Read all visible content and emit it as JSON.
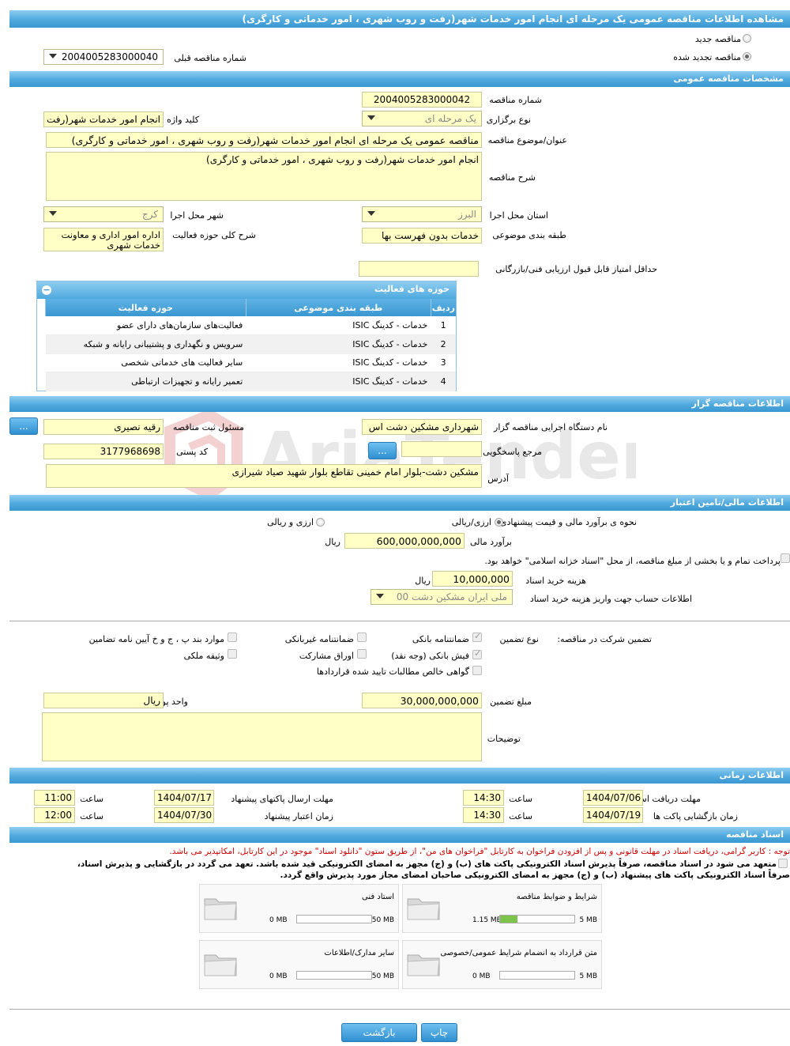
{
  "page_title": "مشاهده اطلاعات مناقصه عمومی یک مرحله ای انجام امور خدمات شهر(رفت و روب شهری ، امور خدماتی و کارگری)",
  "tender_type": {
    "new_label": "مناقصه جدید",
    "renewed_label": "مناقصه تجدید شده",
    "previous_number_label": "شماره مناقصه قبلی",
    "previous_number_value": "2004005283000040"
  },
  "general": {
    "header": "مشخصات مناقصه عمومی",
    "number_label": "شماره مناقصه",
    "number_value": "2004005283000042",
    "holding_type_label": "نوع برگزاری",
    "holding_type_value": "یک مرحله ای",
    "keyword_label": "کلید واژه",
    "keyword_value": "انجام امور خدمات شهر(رفت",
    "subject_label": "عنوان/موضوع مناقصه",
    "subject_value": "مناقصه عمومی یک مرحله ای انجام امور خدمات شهر(رفت و روب شهری ، امور خدماتی و کارگری)",
    "description_label": "شرح مناقصه",
    "description_value": "انجام امور خدمات شهر(رفت و روب شهری ، امور خدماتی و کارگری)",
    "province_label": "استان محل اجرا",
    "province_value": "البرز",
    "city_label": "شهر محل اجرا",
    "city_value": "کرج",
    "category_label": "طبقه بندی موضوعی",
    "category_value": "خدمات بدون فهرست بها",
    "activity_scope_label": "شرح کلی حوزه فعالیت",
    "activity_scope_value": "اداره امور اداری و معاونت خدمات شهری",
    "min_score_label": "حداقل امتیاز قابل قبول ارزیابی فنی/بازرگانی",
    "min_score_value": ""
  },
  "activities": {
    "header": "حوزه های فعالیت",
    "columns": [
      "ردیف",
      "طبقه بندی موضوعی",
      "حوزه فعالیت"
    ],
    "rows": [
      {
        "row": "1",
        "category": "خدمات - کدینگ ISIC",
        "field": "فعالیت‌های سازمان‌های دارای عضو"
      },
      {
        "row": "2",
        "category": "خدمات - کدینگ ISIC",
        "field": "سرویس و نگهداری و پشتیبانی رایانه و شبکه"
      },
      {
        "row": "3",
        "category": "خدمات - کدینگ ISIC",
        "field": "سایر فعالیت های خدماتی شخصی"
      },
      {
        "row": "4",
        "category": "خدمات - کدینگ ISIC",
        "field": "تعمیر رایانه و تجهیزات ارتباطی"
      }
    ]
  },
  "organizer": {
    "header": "اطلاعات مناقصه گزار",
    "org_name_label": "نام دستگاه اجرایی مناقصه گزار",
    "org_name_value": "شهرداری مشکین دشت اس",
    "registrar_label": "مسئول ثبت مناقصه",
    "registrar_value": "رقیه نصیری",
    "reference_label": "مرجع پاسخگویی",
    "reference_value": "",
    "postal_code_label": "کد پستی",
    "postal_code_value": "3177968698",
    "address_label": "آدرس",
    "address_value": "مشکین دشت-بلوار امام خمینی تقاطع بلوار شهید صیاد شیرازی",
    "dots_button": "..."
  },
  "financial": {
    "header": "اطلاعات مالی/تامین اعتبار",
    "estimate_method_label": "نحوه ی برآورد مالی و قیمت پیشنهادی",
    "option_fx_rial": "ارزی/ریالی",
    "option_fx_and_rial": "ارزی و ریالی",
    "estimate_label": "برآورد مالی",
    "estimate_value": "600,000,000,000",
    "currency_rial": "ریال",
    "treasury_text": "پرداخت تمام و یا بخشی از مبلغ مناقصه، از محل \"اسناد خزانه اسلامی\" خواهد بود.",
    "doc_fee_label": "هزینه خرید اسناد",
    "doc_fee_value": "10,000,000",
    "account_label": "اطلاعات حساب جهت واریز هزینه خرید اسناد",
    "account_value": "ملی ایران مشکین دشت 00"
  },
  "guarantee": {
    "participation_label": "تضمین شرکت در مناقصه:",
    "type_label": "نوع تضمین",
    "options": {
      "bank_guarantee": "ضمانتنامه بانکی",
      "bank_receipt": "فیش بانکی (وجه نقد)",
      "net_claims": "گواهی خالص مطالبات تایید شده قراردادها",
      "non_bank_guarantee": "ضمانتنامه غیربانکی",
      "partnership_bonds": "اوراق مشارکت",
      "clauses": "موارد بند پ ، ج و خ آیین نامه تضامین",
      "property_collateral": "وثیقه ملکی"
    },
    "amount_label": "مبلغ تضمین",
    "amount_value": "30,000,000,000",
    "currency_label": "واحد پول",
    "currency_value": "ریال",
    "notes_label": "توضیحات",
    "notes_value": ""
  },
  "timing": {
    "header": "اطلاعات زمانی",
    "doc_receive_label": "مهلت دریافت اسناد",
    "doc_receive_date": "1404/07/06",
    "doc_receive_time": "14:30",
    "submit_label": "مهلت ارسال پاکتهای پیشنهاد",
    "submit_date": "1404/07/17",
    "submit_time": "11:00",
    "opening_label": "زمان بازگشایی پاکت ها",
    "opening_date": "1404/07/19",
    "opening_time": "14:30",
    "validity_label": "زمان اعتبار پیشنهاد",
    "validity_date": "1404/07/30",
    "validity_time": "12:00",
    "time_label": "ساعت"
  },
  "documents": {
    "header": "اسناد مناقصه",
    "notice_red": "توجه : کاربر گرامی، دریافت اسناد در مهلت قانونی و پس از افزودن فراخوان به کارتابل \"فراخوان های من\"، از طریق ستون \"دانلود اسناد\" موجود در این کارتابل، امکانپذیر می باشد.",
    "commitment_1": "متعهد می شود در اسناد مناقصه، صرفاً پذیرش اسناد الکترونیکی پاکت های (ب) و (ج) مجهز به امضای الکترونیکی قید شده باشد. تعهد می گردد در بازگشایی و پذیرش اسناد،",
    "commitment_2": "صرفاً اسناد الکترونیکی پاکت های پیشنهاد (ب) و (ج) مجهز به امضای الکترونیکی صاحبان امضای مجاز مورد پذیرش واقع گردد.",
    "files": [
      {
        "title": "شرایط و ضوابط مناقصه",
        "current": "1.15 MB",
        "max": "5 MB",
        "fill": 0.23
      },
      {
        "title": "استاد فنی",
        "current": "0 MB",
        "max": "50 MB",
        "fill": 0
      },
      {
        "title": "متن قرارداد به انضمام شرایط عمومی/خصوصی",
        "current": "0 MB",
        "max": "5 MB",
        "fill": 0
      },
      {
        "title": "سایر مدارک/اطلاعات",
        "current": "0 MB",
        "max": "50 MB",
        "fill": 0
      }
    ]
  },
  "actions": {
    "print": "چاپ",
    "back": "بازگشت"
  },
  "watermark": "AriaTender.neT",
  "colors": {
    "header_blue": "#4fa9de",
    "field_yellow": "#ffffc6",
    "notice_red": "#d00000"
  }
}
